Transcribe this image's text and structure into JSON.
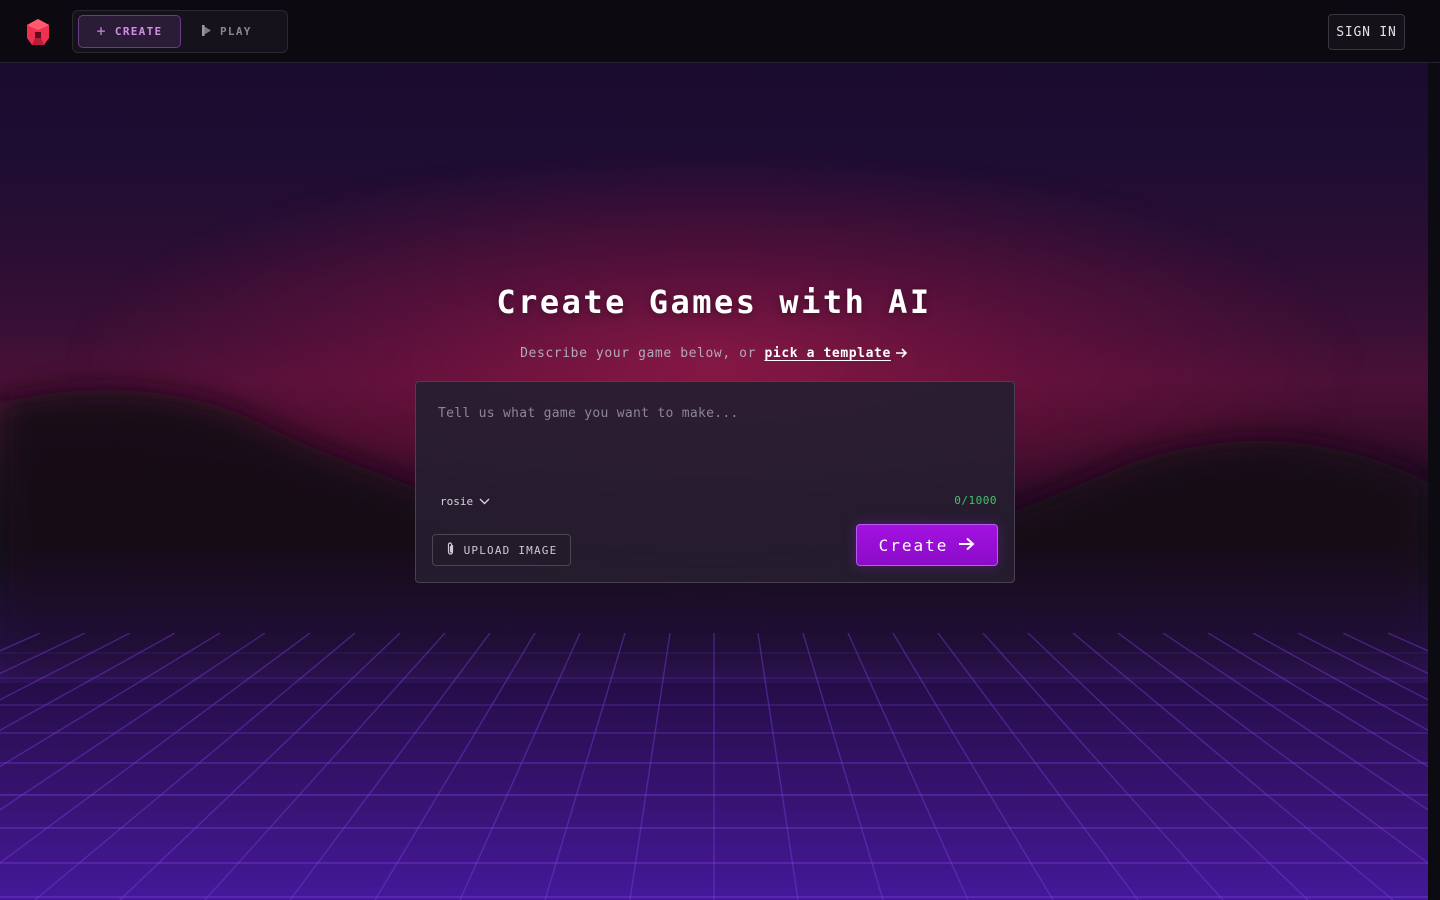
{
  "nav": {
    "create_tab_label": "CREATE",
    "play_tab_label": "PLAY",
    "sign_in_label": "SIGN IN"
  },
  "hero": {
    "title": "Create Games with AI",
    "subtitle_prefix": "Describe your game below, or",
    "subtitle_link": "pick a template"
  },
  "prompt": {
    "placeholder": "Tell us what game you want to make...",
    "value": "",
    "model": "rosie",
    "counter": "0/1000",
    "upload_label": "UPLOAD IMAGE",
    "create_label": "Create"
  },
  "icons": {
    "logo": "brand-logo",
    "create_tab": "plus-icon",
    "play_tab": "play-icon",
    "subtitle_link": "arrow-right-icon",
    "model": "chevron-down-icon",
    "upload": "paperclip-icon",
    "create": "arrow-right-icon"
  },
  "colors": {
    "accent": "#a311e0",
    "logo_red": "#f0304f",
    "counter_green": "#3fc46b",
    "create_tab_text": "#d28ee6"
  }
}
